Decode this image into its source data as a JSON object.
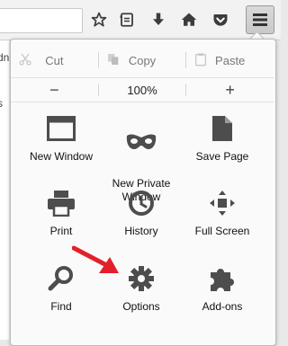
{
  "toolbar": {
    "icons": [
      "bookmark-star-icon",
      "reading-list-icon",
      "download-icon",
      "home-icon",
      "pocket-icon",
      "hamburger-menu-icon"
    ]
  },
  "page": {
    "fragment_top": "dn",
    "fragment_bottom": "s"
  },
  "edit_row": {
    "cut": "Cut",
    "copy": "Copy",
    "paste": "Paste"
  },
  "zoom_row": {
    "minus": "−",
    "level": "100%",
    "plus": "+"
  },
  "items": [
    {
      "label": "New Window",
      "icon": "window-icon"
    },
    {
      "label": "New Private\nWindow",
      "icon": "private-mask-icon"
    },
    {
      "label": "Save Page",
      "icon": "save-page-icon"
    },
    {
      "label": "Print",
      "icon": "printer-icon"
    },
    {
      "label": "History",
      "icon": "clock-icon"
    },
    {
      "label": "Full Screen",
      "icon": "fullscreen-icon"
    },
    {
      "label": "Find",
      "icon": "magnifier-icon"
    },
    {
      "label": "Options",
      "icon": "gear-icon"
    },
    {
      "label": "Add-ons",
      "icon": "puzzle-icon"
    }
  ],
  "colors": {
    "icon": "#4d4d4d",
    "annotation_arrow": "#e3202a",
    "panel": "#fafafa"
  }
}
